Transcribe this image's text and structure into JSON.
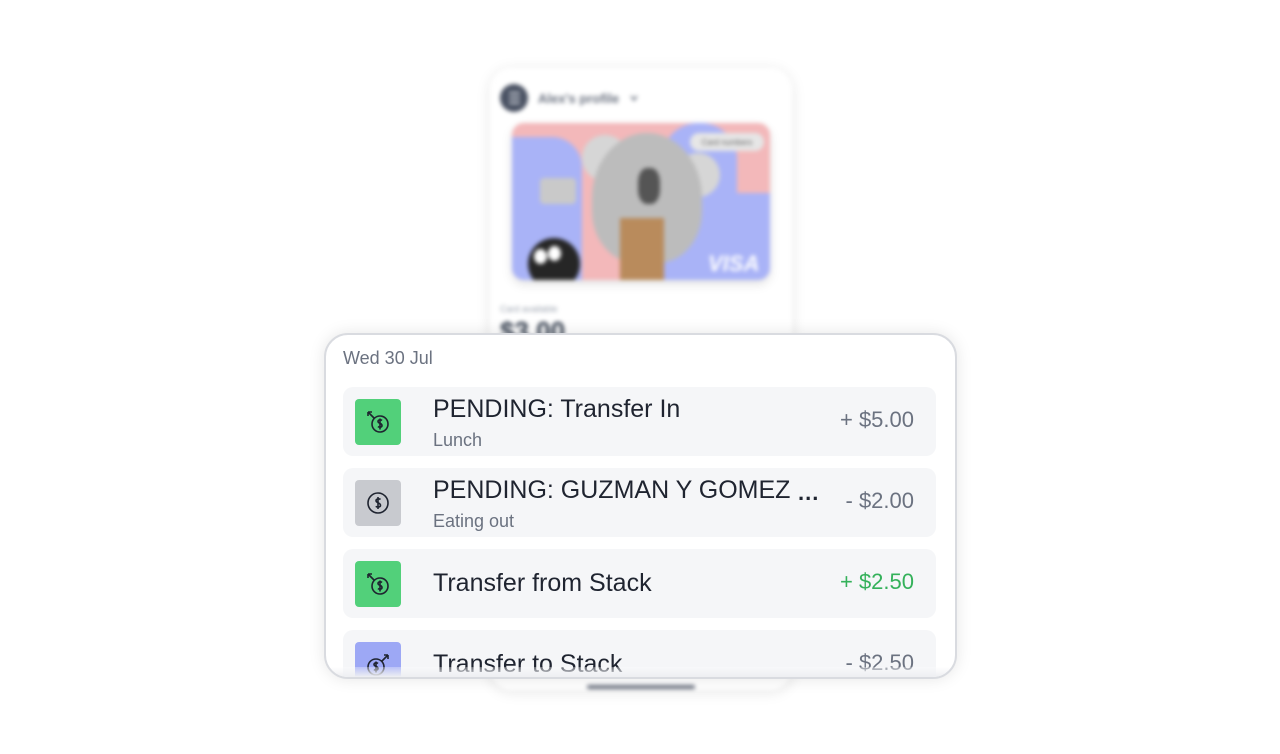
{
  "phone": {
    "profile_label": "Alex's profile",
    "card": {
      "numbers_pill": "Card numbers",
      "network": "VISA"
    },
    "available_label": "Card available",
    "available_amount": "$3.00"
  },
  "panel": {
    "date_heading": "Wed 30 Jul",
    "transactions": [
      {
        "title": "PENDING: Transfer In",
        "subtitle": "Lunch",
        "amount": "+ $5.00",
        "icon": "transfer-in-icon",
        "icon_color": "#52d07a",
        "amount_color": "#6b7280"
      },
      {
        "title": "PENDING: GUZMAN Y GOMEZ",
        "subtitle": "Eating out",
        "amount": "- $2.00",
        "icon": "dollar-coin-icon",
        "icon_color": "#c8cacf",
        "amount_color": "#6b7280",
        "more": "..."
      },
      {
        "title": "Transfer from Stack",
        "subtitle": "",
        "amount": "+ $2.50",
        "icon": "transfer-in-icon",
        "icon_color": "#52d07a",
        "amount_color": "#34b15a"
      },
      {
        "title": "Transfer to Stack",
        "subtitle": "",
        "amount": "- $2.50",
        "icon": "transfer-out-icon",
        "icon_color": "#9da8f5",
        "amount_color": "#6b7280"
      }
    ]
  }
}
